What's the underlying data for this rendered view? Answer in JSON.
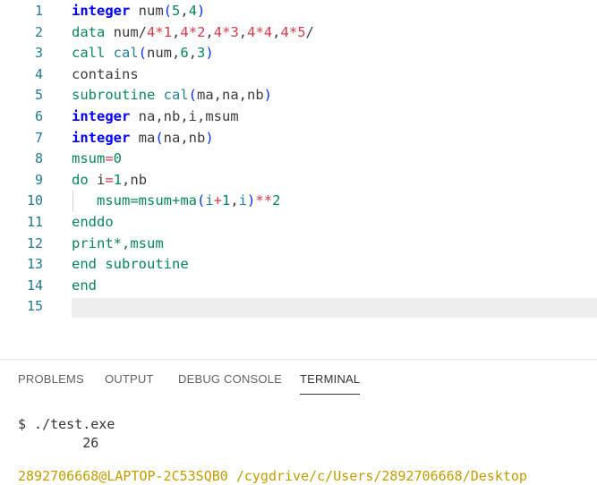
{
  "editor": {
    "lines": [
      {
        "n": "1",
        "tokens": [
          [
            "integer",
            "kw"
          ],
          [
            " num",
            "id"
          ],
          [
            "(",
            "br"
          ],
          [
            "5",
            "num"
          ],
          [
            ",",
            "id"
          ],
          [
            "4",
            "num"
          ],
          [
            ")",
            "br"
          ]
        ]
      },
      {
        "n": "2",
        "tokens": [
          [
            "data",
            "grn"
          ],
          [
            " num/",
            "id"
          ],
          [
            "4",
            "op"
          ],
          [
            "*",
            "op"
          ],
          [
            "1",
            "op"
          ],
          [
            ",",
            "id"
          ],
          [
            "4",
            "op"
          ],
          [
            "*",
            "op"
          ],
          [
            "2",
            "op"
          ],
          [
            ",",
            "id"
          ],
          [
            "4",
            "op"
          ],
          [
            "*",
            "op"
          ],
          [
            "3",
            "op"
          ],
          [
            ",",
            "id"
          ],
          [
            "4",
            "op"
          ],
          [
            "*",
            "op"
          ],
          [
            "4",
            "op"
          ],
          [
            ",",
            "id"
          ],
          [
            "4",
            "op"
          ],
          [
            "*",
            "op"
          ],
          [
            "5",
            "op"
          ],
          [
            "/",
            "id"
          ]
        ]
      },
      {
        "n": "3",
        "tokens": [
          [
            "call",
            "grn"
          ],
          [
            " ",
            "id"
          ],
          [
            "cal",
            "fn"
          ],
          [
            "(",
            "br"
          ],
          [
            "num",
            "id"
          ],
          [
            ",",
            "id"
          ],
          [
            "6",
            "num"
          ],
          [
            ",",
            "id"
          ],
          [
            "3",
            "num"
          ],
          [
            ")",
            "br"
          ]
        ]
      },
      {
        "n": "4",
        "tokens": [
          [
            "contains",
            "id"
          ]
        ]
      },
      {
        "n": "5",
        "tokens": [
          [
            "subroutine",
            "grn"
          ],
          [
            " ",
            "id"
          ],
          [
            "cal",
            "fn"
          ],
          [
            "(",
            "br"
          ],
          [
            "ma,na,nb",
            "id"
          ],
          [
            ")",
            "br"
          ]
        ]
      },
      {
        "n": "6",
        "tokens": [
          [
            "integer",
            "kw"
          ],
          [
            " na,nb,i,msum",
            "id"
          ]
        ]
      },
      {
        "n": "7",
        "tokens": [
          [
            "integer",
            "kw"
          ],
          [
            " ma",
            "id"
          ],
          [
            "(",
            "br"
          ],
          [
            "na,nb",
            "id"
          ],
          [
            ")",
            "br"
          ]
        ]
      },
      {
        "n": "8",
        "tokens": [
          [
            "msum",
            "grn"
          ],
          [
            "=",
            "op"
          ],
          [
            "0",
            "num"
          ]
        ]
      },
      {
        "n": "9",
        "tokens": [
          [
            "do",
            "grn"
          ],
          [
            " i",
            "id"
          ],
          [
            "=",
            "op"
          ],
          [
            "1",
            "num"
          ],
          [
            ",nb",
            "id"
          ]
        ]
      },
      {
        "n": "10",
        "tokens": [
          [
            "   msum=msum+ma",
            "grn"
          ],
          [
            "(",
            "br"
          ],
          [
            "i",
            "fn"
          ],
          [
            "+",
            "op"
          ],
          [
            "1",
            "num"
          ],
          [
            ",",
            "id"
          ],
          [
            "i",
            "fn"
          ],
          [
            ")",
            "br"
          ],
          [
            "**",
            "op"
          ],
          [
            "2",
            "num"
          ]
        ]
      },
      {
        "n": "11",
        "tokens": [
          [
            "enddo",
            "grn"
          ]
        ]
      },
      {
        "n": "12",
        "tokens": [
          [
            "print*,msum",
            "grn"
          ]
        ]
      },
      {
        "n": "13",
        "tokens": [
          [
            "end subroutine",
            "grn"
          ]
        ]
      },
      {
        "n": "14",
        "tokens": [
          [
            "end",
            "grn"
          ]
        ]
      },
      {
        "n": "15",
        "tokens": []
      }
    ]
  },
  "panel": {
    "tabs": [
      "PROBLEMS",
      "OUTPUT",
      "DEBUG CONSOLE",
      "TERMINAL"
    ],
    "active_tab": "TERMINAL"
  },
  "terminal": {
    "command": "$ ./test.exe",
    "output": "        26",
    "prompt": "2892706668@LAPTOP-2C53SQB0 /cygdrive/c/Users/2892706668/Desktop"
  }
}
